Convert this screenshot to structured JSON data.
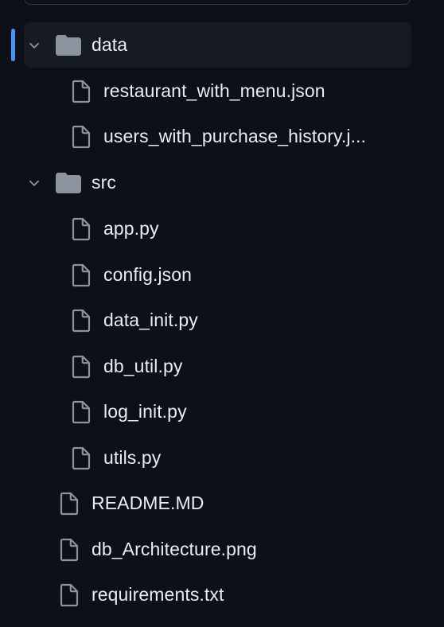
{
  "tree": {
    "folders": [
      {
        "name": "data",
        "expanded": true,
        "selected": true,
        "files": [
          "restaurant_with_menu.json",
          "users_with_purchase_history.j..."
        ]
      },
      {
        "name": "src",
        "expanded": true,
        "selected": false,
        "files": [
          "app.py",
          "config.json",
          "data_init.py",
          "db_util.py",
          "log_init.py",
          "utils.py"
        ]
      }
    ],
    "root_files": [
      "README.MD",
      "db_Architecture.png",
      "requirements.txt"
    ]
  },
  "colors": {
    "background": "#0d1117",
    "text": "#e6edf3",
    "icon": "#8b949e",
    "selected_row": "#161b22",
    "accent": "#4493f8"
  },
  "icons": {
    "folder": "file-directory-fill-icon",
    "file": "file-icon",
    "chevron": "chevron-down-icon"
  }
}
